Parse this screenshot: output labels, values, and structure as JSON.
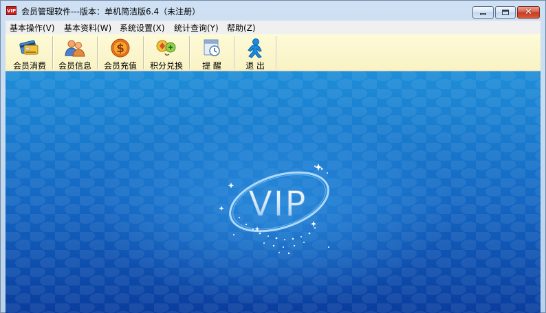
{
  "window": {
    "title": "会员管理软件---版本：单机简洁版6.4（未注册）",
    "app_icon_text": "VIP"
  },
  "menu": {
    "items": [
      {
        "label": "基本操作(V)"
      },
      {
        "label": "基本资料(W)"
      },
      {
        "label": "系统设置(X)"
      },
      {
        "label": "统计查询(Y)"
      },
      {
        "label": "帮助(Z)"
      }
    ]
  },
  "toolbar": {
    "items": [
      {
        "label": "会员消费",
        "icon": "credit-card-icon"
      },
      {
        "label": "会员信息",
        "icon": "users-icon"
      },
      {
        "label": "会员充值",
        "icon": "dollar-coin-icon"
      },
      {
        "label": "积分兑换",
        "icon": "exchange-icon"
      },
      {
        "label": "提 醒",
        "icon": "reminder-icon"
      },
      {
        "label": "退 出",
        "icon": "exit-person-icon"
      }
    ]
  },
  "content": {
    "logo_text": "VIP"
  },
  "colors": {
    "background_top": "#1f8ed8",
    "background_bottom": "#0a3d9e",
    "toolbar_bg": "#fbf6cd",
    "close_button": "#c8391f"
  }
}
